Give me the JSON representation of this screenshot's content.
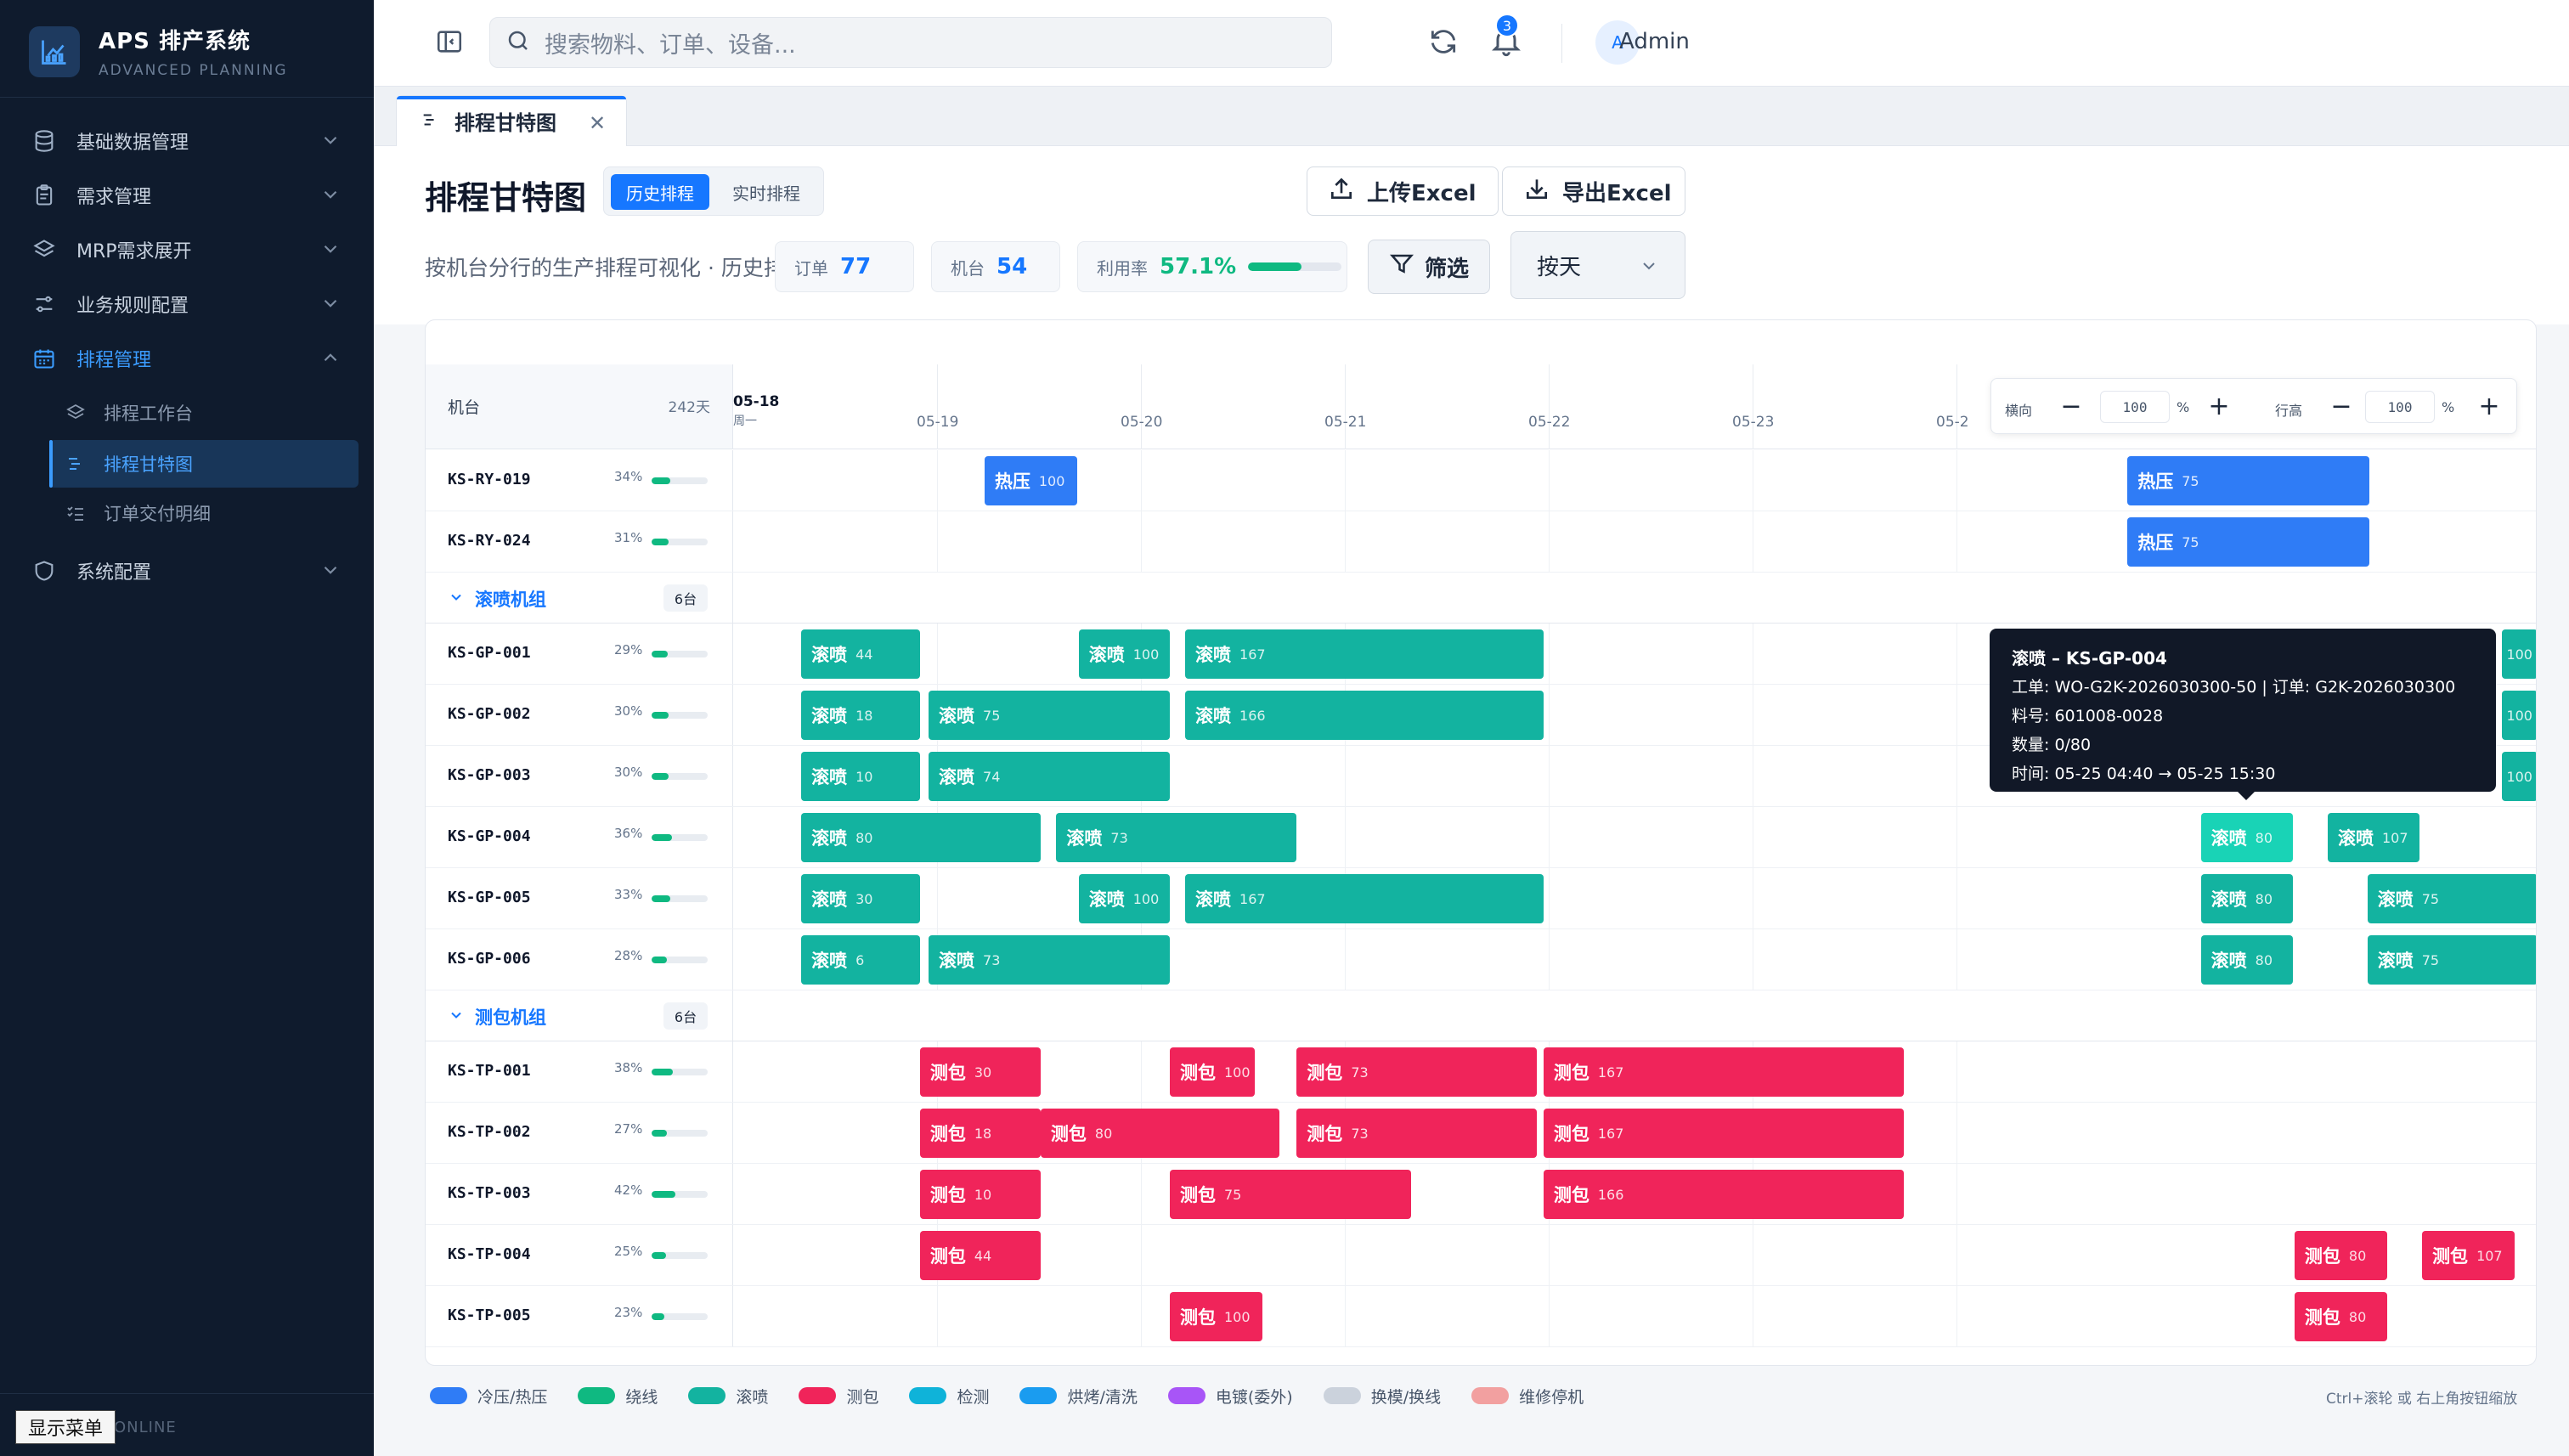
{
  "app": {
    "title": "APS 排产系统",
    "subtitle": "ADVANCED PLANNING"
  },
  "sidebar": {
    "items": [
      {
        "label": "基础数据管理",
        "icon": "database-icon"
      },
      {
        "label": "需求管理",
        "icon": "clipboard-icon"
      },
      {
        "label": "MRP需求展开",
        "icon": "layers-icon"
      },
      {
        "label": "业务规则配置",
        "icon": "sliders-icon"
      },
      {
        "label": "排程管理",
        "icon": "calendar-icon"
      },
      {
        "label": "系统配置",
        "icon": "shield-icon"
      }
    ],
    "subitems": [
      {
        "label": "排程工作台",
        "icon": "layers-icon"
      },
      {
        "label": "排程甘特图",
        "icon": "gantt-icon"
      },
      {
        "label": "订单交付明细",
        "icon": "checklist-icon"
      }
    ],
    "status": "ONLINE",
    "show_menu": "显示菜单"
  },
  "topbar": {
    "search_placeholder": "搜索物料、订单、设备...",
    "notifications": "3",
    "avatar": "A",
    "user": "Admin"
  },
  "tabs": [
    {
      "label": "排程甘特图"
    }
  ],
  "header": {
    "title": "排程甘特图",
    "mode_history": "历史排程",
    "mode_realtime": "实时排程",
    "subtitle": "按机台分行的生产排程可视化 · 历史排程数据",
    "upload": "上传Excel",
    "export": "导出Excel",
    "stats": {
      "orders_label": "订单",
      "orders": "77",
      "machines_label": "机台",
      "machines": "54",
      "util_label": "利用率",
      "util": "57.1%",
      "util_value": 0.571
    },
    "filter": "筛选",
    "granularity": "按天"
  },
  "gantt": {
    "col_machine": "机台",
    "col_days": "242天",
    "first_date": "05-18",
    "first_weekday": "周一",
    "dates": [
      "05-19",
      "05-20",
      "05-21",
      "05-22",
      "05-23",
      "05-2"
    ],
    "zoom": {
      "h_label": "横向",
      "h_value": "100",
      "r_label": "行高",
      "r_value": "100",
      "pct": "%"
    },
    "rows": [
      {
        "type": "machine",
        "name": "KS-RY-019",
        "pct": "34%",
        "util": 0.34,
        "bars": [
          {
            "start": 0.1393,
            "end": 0.1906,
            "label": "热压",
            "qty": "100",
            "color": "#2f7cf6"
          },
          {
            "start": 0.7727,
            "end": 0.9068,
            "label": "热压",
            "qty": "75",
            "color": "#2f7cf6"
          }
        ]
      },
      {
        "type": "machine",
        "name": "KS-RY-024",
        "pct": "31%",
        "util": 0.31,
        "bars": [
          {
            "start": 0.7727,
            "end": 0.9068,
            "label": "热压",
            "qty": "75",
            "color": "#2f7cf6"
          }
        ]
      },
      {
        "type": "group",
        "name": "滚喷机组",
        "count": "6台"
      },
      {
        "type": "machine",
        "name": "KS-GP-001",
        "pct": "29%",
        "util": 0.29,
        "bars": [
          {
            "start": 0.0377,
            "end": 0.1035,
            "label": "滚喷",
            "qty": "44",
            "color": "#13b3a0"
          },
          {
            "start": 0.1915,
            "end": 0.242,
            "label": "滚喷",
            "qty": "100",
            "color": "#13b3a0"
          },
          {
            "start": 0.2505,
            "end": 0.4491,
            "label": "滚喷",
            "qty": "167",
            "color": "#13b3a0"
          },
          {
            "start": 0.9802,
            "end": 1.02,
            "label": "",
            "qty": "100",
            "color": "#13b3a0"
          }
        ]
      },
      {
        "type": "machine",
        "name": "KS-GP-002",
        "pct": "30%",
        "util": 0.3,
        "bars": [
          {
            "start": 0.0377,
            "end": 0.1035,
            "label": "滚喷",
            "qty": "18",
            "color": "#13b3a0"
          },
          {
            "start": 0.1083,
            "end": 0.242,
            "label": "滚喷",
            "qty": "75",
            "color": "#13b3a0"
          },
          {
            "start": 0.2505,
            "end": 0.4491,
            "label": "滚喷",
            "qty": "166",
            "color": "#13b3a0"
          },
          {
            "start": 0.9802,
            "end": 1.02,
            "label": "",
            "qty": "100",
            "color": "#13b3a0"
          }
        ]
      },
      {
        "type": "machine",
        "name": "KS-GP-003",
        "pct": "30%",
        "util": 0.3,
        "bars": [
          {
            "start": 0.0377,
            "end": 0.1035,
            "label": "滚喷",
            "qty": "10",
            "color": "#13b3a0"
          },
          {
            "start": 0.1083,
            "end": 0.242,
            "label": "滚喷",
            "qty": "74",
            "color": "#13b3a0"
          },
          {
            "start": 0.9802,
            "end": 1.02,
            "label": "",
            "qty": "100",
            "color": "#13b3a0"
          }
        ]
      },
      {
        "type": "machine",
        "name": "KS-GP-004",
        "pct": "36%",
        "util": 0.36,
        "bars": [
          {
            "start": 0.0377,
            "end": 0.1704,
            "label": "滚喷",
            "qty": "80",
            "color": "#13b3a0"
          },
          {
            "start": 0.1791,
            "end": 0.3123,
            "label": "滚喷",
            "qty": "73",
            "color": "#13b3a0"
          },
          {
            "start": 0.8134,
            "end": 0.8644,
            "label": "滚喷",
            "qty": "80",
            "color": "#19d3b6"
          },
          {
            "start": 0.8837,
            "end": 0.9345,
            "label": "滚喷",
            "qty": "107",
            "color": "#13b3a0"
          }
        ]
      },
      {
        "type": "machine",
        "name": "KS-GP-005",
        "pct": "33%",
        "util": 0.33,
        "bars": [
          {
            "start": 0.0377,
            "end": 0.1035,
            "label": "滚喷",
            "qty": "30",
            "color": "#13b3a0"
          },
          {
            "start": 0.1915,
            "end": 0.242,
            "label": "滚喷",
            "qty": "100",
            "color": "#13b3a0"
          },
          {
            "start": 0.2505,
            "end": 0.4491,
            "label": "滚喷",
            "qty": "167",
            "color": "#13b3a0"
          },
          {
            "start": 0.8134,
            "end": 0.8644,
            "label": "滚喷",
            "qty": "80",
            "color": "#13b3a0"
          },
          {
            "start": 0.9057,
            "end": 1.02,
            "label": "滚喷",
            "qty": "75",
            "color": "#13b3a0"
          }
        ]
      },
      {
        "type": "machine",
        "name": "KS-GP-006",
        "pct": "28%",
        "util": 0.28,
        "bars": [
          {
            "start": 0.0377,
            "end": 0.1035,
            "label": "滚喷",
            "qty": "6",
            "color": "#13b3a0"
          },
          {
            "start": 0.1083,
            "end": 0.242,
            "label": "滚喷",
            "qty": "73",
            "color": "#13b3a0"
          },
          {
            "start": 0.8134,
            "end": 0.8644,
            "label": "滚喷",
            "qty": "80",
            "color": "#13b3a0"
          },
          {
            "start": 0.9057,
            "end": 1.02,
            "label": "滚喷",
            "qty": "75",
            "color": "#13b3a0"
          }
        ]
      },
      {
        "type": "group",
        "name": "测包机组",
        "count": "6台"
      },
      {
        "type": "machine",
        "name": "KS-TP-001",
        "pct": "38%",
        "util": 0.38,
        "bars": [
          {
            "start": 0.1035,
            "end": 0.1704,
            "label": "测包",
            "qty": "30",
            "color": "#f0245a"
          },
          {
            "start": 0.242,
            "end": 0.2891,
            "label": "测包",
            "qty": "100",
            "color": "#f0245a"
          },
          {
            "start": 0.3123,
            "end": 0.4453,
            "label": "测包",
            "qty": "73",
            "color": "#f0245a"
          },
          {
            "start": 0.4491,
            "end": 0.6489,
            "label": "测包",
            "qty": "167",
            "color": "#f0245a"
          }
        ]
      },
      {
        "type": "machine",
        "name": "KS-TP-002",
        "pct": "27%",
        "util": 0.27,
        "bars": [
          {
            "start": 0.1035,
            "end": 0.1704,
            "label": "测包",
            "qty": "18",
            "color": "#f0245a"
          },
          {
            "start": 0.1704,
            "end": 0.3028,
            "label": "测包",
            "qty": "80",
            "color": "#f0245a"
          },
          {
            "start": 0.3123,
            "end": 0.4453,
            "label": "测包",
            "qty": "73",
            "color": "#f0245a"
          },
          {
            "start": 0.4491,
            "end": 0.6489,
            "label": "测包",
            "qty": "167",
            "color": "#f0245a"
          }
        ]
      },
      {
        "type": "machine",
        "name": "KS-TP-003",
        "pct": "42%",
        "util": 0.42,
        "bars": [
          {
            "start": 0.1035,
            "end": 0.1704,
            "label": "测包",
            "qty": "10",
            "color": "#f0245a"
          },
          {
            "start": 0.242,
            "end": 0.3755,
            "label": "测包",
            "qty": "75",
            "color": "#f0245a"
          },
          {
            "start": 0.4491,
            "end": 0.6489,
            "label": "测包",
            "qty": "166",
            "color": "#f0245a"
          }
        ]
      },
      {
        "type": "machine",
        "name": "KS-TP-004",
        "pct": "25%",
        "util": 0.25,
        "bars": [
          {
            "start": 0.1035,
            "end": 0.1704,
            "label": "测包",
            "qty": "44",
            "color": "#f0245a"
          },
          {
            "start": 0.8653,
            "end": 0.9166,
            "label": "测包",
            "qty": "80",
            "color": "#f0245a"
          },
          {
            "start": 0.936,
            "end": 0.9873,
            "label": "测包",
            "qty": "107",
            "color": "#f0245a"
          }
        ]
      },
      {
        "type": "machine",
        "name": "KS-TP-005",
        "pct": "23%",
        "util": 0.23,
        "bars": [
          {
            "start": 0.242,
            "end": 0.2933,
            "label": "测包",
            "qty": "100",
            "color": "#f0245a"
          },
          {
            "start": 0.8653,
            "end": 0.9166,
            "label": "测包",
            "qty": "80",
            "color": "#f0245a"
          }
        ]
      }
    ],
    "tooltip": {
      "title": "滚喷 – KS-GP-004",
      "line1": "工单: WO-G2K-2026030300-50 | 订单: G2K-2026030300",
      "line2": "料号: 601008-0028",
      "line3": "数量: 0/80",
      "line4": "时间: 05-25 04:40 → 05-25 15:30"
    }
  },
  "legend": [
    {
      "label": "冷压/热压",
      "color": "#2f7cf6"
    },
    {
      "label": "绕线",
      "color": "#0fb981"
    },
    {
      "label": "滚喷",
      "color": "#13b3a0"
    },
    {
      "label": "测包",
      "color": "#f0245a"
    },
    {
      "label": "检测",
      "color": "#0fb3d9"
    },
    {
      "label": "烘烤/清洗",
      "color": "#1a9cf0"
    },
    {
      "label": "电镀(委外)",
      "color": "#a855f7"
    },
    {
      "label": "换模/换线",
      "color": "#cbd2dc"
    },
    {
      "label": "维修停机",
      "color": "#f2a0a0"
    }
  ],
  "hint": "Ctrl+滚轮 或 右上角按钮缩放"
}
